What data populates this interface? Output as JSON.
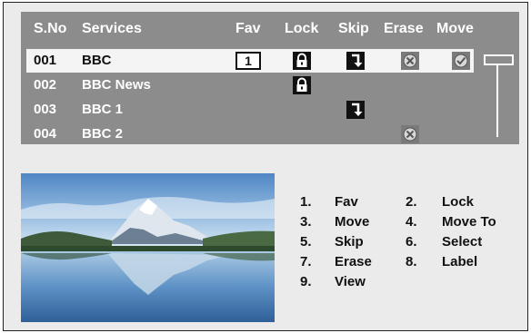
{
  "header": {
    "sno": "S.No",
    "services": "Services",
    "fav": "Fav",
    "lock": "Lock",
    "skip": "Skip",
    "erase": "Erase",
    "move": "Move"
  },
  "rows": [
    {
      "num": "001",
      "name": "BBC",
      "fav": "1",
      "lock": true,
      "skip": true,
      "erase": true,
      "move": true,
      "selected": true
    },
    {
      "num": "002",
      "name": "BBC News",
      "lock": true
    },
    {
      "num": "003",
      "name": "BBC 1",
      "skip": true
    },
    {
      "num": "004",
      "name": "BBC 2",
      "erase": true
    }
  ],
  "legend": [
    {
      "num": "1.",
      "label": "Fav"
    },
    {
      "num": "2.",
      "label": "Lock"
    },
    {
      "num": "3.",
      "label": "Move"
    },
    {
      "num": "4.",
      "label": "Move To"
    },
    {
      "num": "5.",
      "label": "Skip"
    },
    {
      "num": "6.",
      "label": "Select"
    },
    {
      "num": "7.",
      "label": "Erase"
    },
    {
      "num": "8.",
      "label": "Label"
    },
    {
      "num": "9.",
      "label": "View"
    }
  ],
  "icons": {
    "lock": "padlock-icon",
    "skip": "skip-arrow-icon",
    "erase": "erase-x-icon",
    "move": "checkmark-icon"
  },
  "colors": {
    "panel": "#8c8c8c",
    "selected_row": "#f4f4f4",
    "text_light": "#ffffff",
    "text_dark": "#111111"
  }
}
